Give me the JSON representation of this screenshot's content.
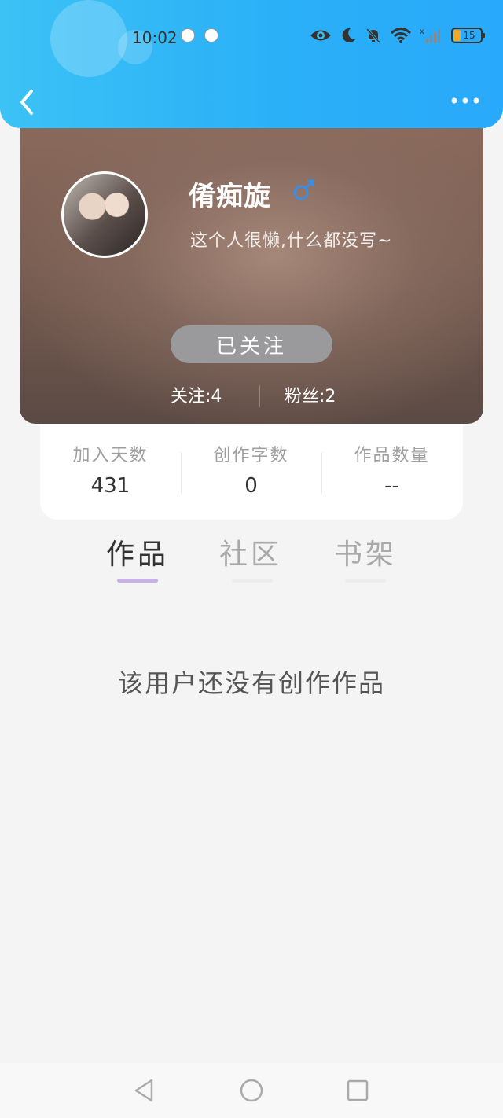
{
  "status_bar": {
    "time": "10:02",
    "battery_level": "15"
  },
  "header": {
    "back_icon": "chevron-left-icon",
    "more_icon": "more-dots-icon",
    "accent_color": "#2aaef7"
  },
  "profile": {
    "username": "倄痴旋",
    "gender_icon": "male-icon",
    "bio": "这个人很懒,什么都没写~",
    "follow_button_label": "已关注",
    "following": "关注:4",
    "followers": "粉丝:2"
  },
  "stats": [
    {
      "label": "加入天数",
      "value": "431"
    },
    {
      "label": "创作字数",
      "value": "0"
    },
    {
      "label": "作品数量",
      "value": "--"
    }
  ],
  "tabs": [
    {
      "label": "作品",
      "active": true
    },
    {
      "label": "社区",
      "active": false
    },
    {
      "label": "书架",
      "active": false
    }
  ],
  "empty_message": "该用户还没有创作作品",
  "navbar": {
    "icons": [
      "back-triangle-icon",
      "home-circle-icon",
      "recent-square-icon"
    ]
  }
}
